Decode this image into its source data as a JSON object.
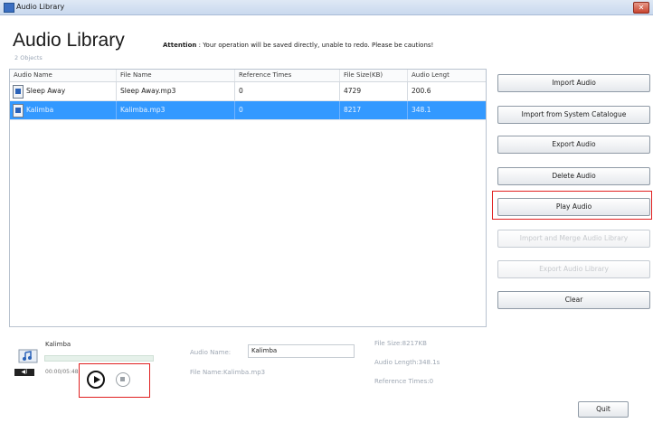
{
  "window": {
    "title": "Audio Library",
    "close_glyph": "✕"
  },
  "header": {
    "title": "Audio Library",
    "attention_label": "Attention",
    "attention_text": " : Your operation will be saved directly, unable to redo. Please be cautions!",
    "count": "2 Objects"
  },
  "table": {
    "columns": [
      "Audio Name",
      "File Name",
      "Reference Times",
      "File Size(KB)",
      "Audio Lengt"
    ],
    "rows": [
      {
        "name": "Sleep Away",
        "file": "Sleep Away.mp3",
        "refs": "0",
        "size": "4729",
        "length": "200.6",
        "selected": false
      },
      {
        "name": "Kalimba",
        "file": "Kalimba.mp3",
        "refs": "0",
        "size": "8217",
        "length": "348.1",
        "selected": true
      }
    ]
  },
  "actions": {
    "import_audio": "Import Audio",
    "import_system": "Import from System Catalogue",
    "export_audio": "Export Audio",
    "delete_audio": "Delete Audio",
    "play_audio": "Play Audio",
    "import_merge": "Import and Merge Audio Library",
    "export_library": "Export Audio Library",
    "clear": "Clear"
  },
  "player": {
    "title": "Kalimba",
    "time": "00:00/05:48",
    "progress": 0.0,
    "speaker_label": "◀)",
    "icons": {
      "play": "play-icon",
      "stop": "stop-icon"
    }
  },
  "details": {
    "audio_name_label": "Audio Name:",
    "audio_name_value": "Kalimba",
    "file_name_line": "File Name:Kalimba.mp3",
    "file_size_line": "File Size:8217KB",
    "audio_length_line": "Audio Length:348.1s",
    "reference_times_line": "Reference Times:0"
  },
  "footer": {
    "quit": "Quit"
  },
  "colors": {
    "selection": "#3399ff",
    "highlight": "#e02020"
  }
}
